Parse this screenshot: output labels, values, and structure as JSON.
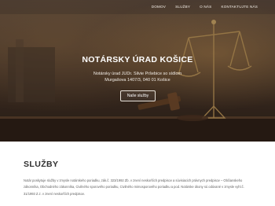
{
  "nav": {
    "items": [
      {
        "label": "DOMOV"
      },
      {
        "label": "SLUŽBY"
      },
      {
        "label": "O NÁS"
      },
      {
        "label": "KONTAKTUJTE NÁS"
      }
    ]
  },
  "hero": {
    "title": "NOTÁRSKY ÚRAD KOŠICE",
    "line1": "Notársky úrad JUDr. Silvie Pršebice so sídlom",
    "line2": "Murgašova 1407/3, 040 01 Košice",
    "button_label": "Naše služby"
  },
  "services": {
    "title": "SLUŽBY",
    "text": "Notár poskytuje služby v zmysle notárskeho poriadku, zák.č. 323/1992 Zb. v znení neskorších predpisov a súvisiacich právnych predpisov – Občianskeho zákonníka, Obchodného zákonníka, Civilného sporového poriadku, Civilného mimosporového poriadku a pod. Notárske úkony sú odúvané v zmysle vyhl.č. 31/1993 Z.z. v znení neskorších predpisov."
  },
  "colors": {
    "hero_dark": "#3e2d22",
    "hero_light": "#6b5544",
    "nav_text": "#f4efe9",
    "heading": "#2e2e2e",
    "body_text": "#5f5f5f"
  }
}
